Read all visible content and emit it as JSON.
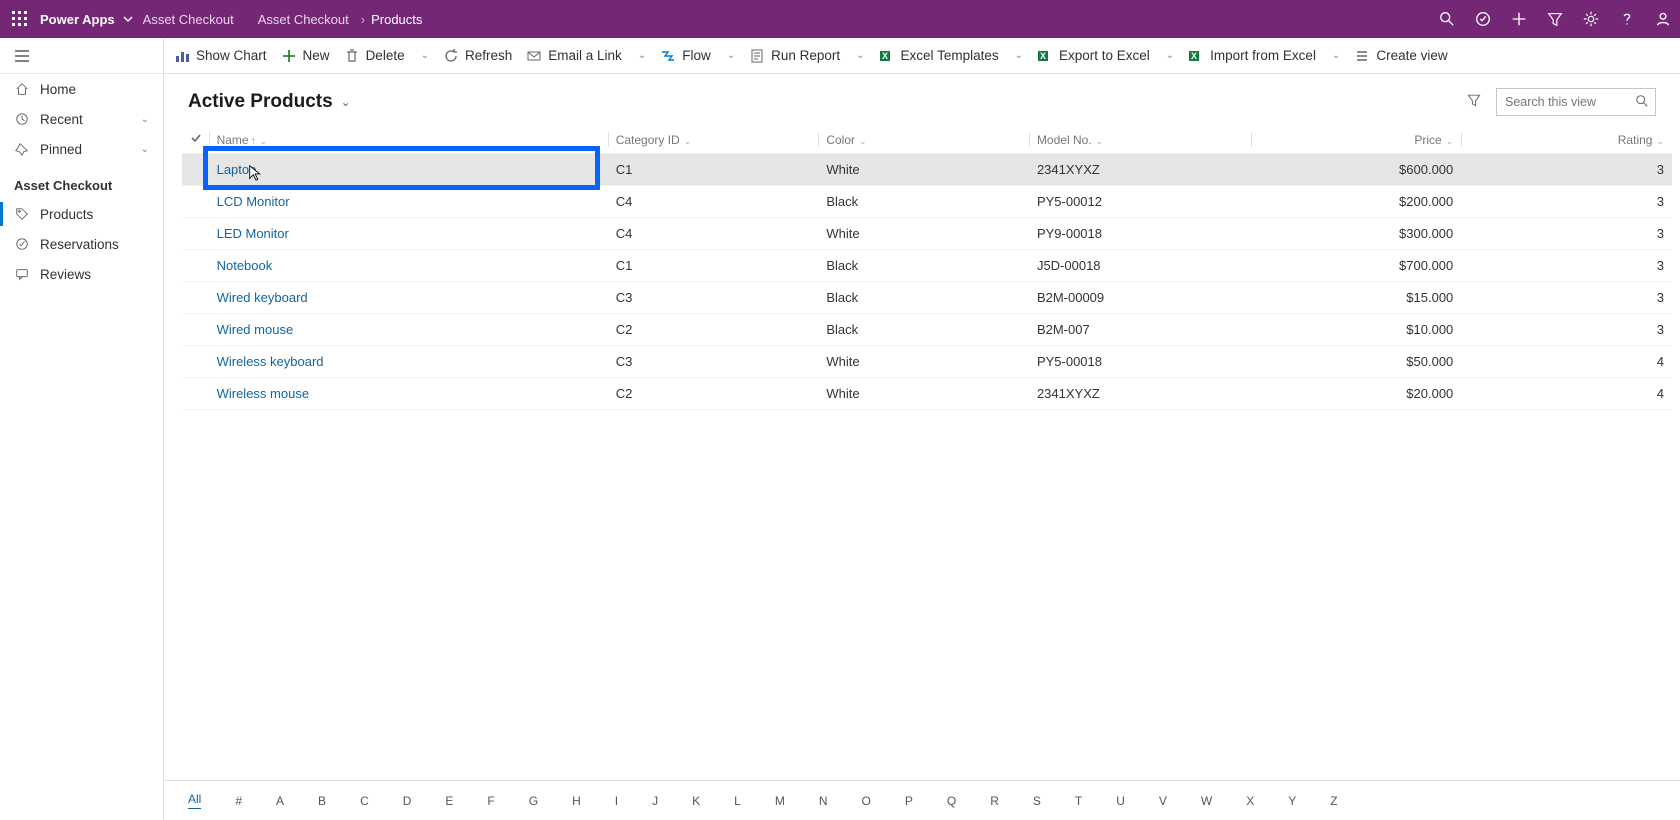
{
  "appbar": {
    "app_name": "Power Apps",
    "env_name": "Asset Checkout",
    "breadcrumb": [
      "Asset Checkout",
      "Products"
    ]
  },
  "commands": {
    "show_chart": "Show Chart",
    "new": "New",
    "delete": "Delete",
    "refresh": "Refresh",
    "email_link": "Email a Link",
    "flow": "Flow",
    "run_report": "Run Report",
    "excel_templates": "Excel Templates",
    "export_excel": "Export to Excel",
    "import_excel": "Import from Excel",
    "create_view": "Create view"
  },
  "nav": {
    "home": "Home",
    "recent": "Recent",
    "pinned": "Pinned",
    "group": "Asset Checkout",
    "products": "Products",
    "reservations": "Reservations",
    "reviews": "Reviews"
  },
  "view": {
    "title": "Active Products",
    "search_placeholder": "Search this view"
  },
  "columns": {
    "name": "Name",
    "category": "Category ID",
    "color": "Color",
    "model": "Model No.",
    "price": "Price",
    "rating": "Rating"
  },
  "rows": [
    {
      "name": "Laptop",
      "category": "C1",
      "color": "White",
      "model": "2341XYXZ",
      "price": "$600.000",
      "rating": "3"
    },
    {
      "name": "LCD Monitor",
      "category": "C4",
      "color": "Black",
      "model": "PY5-00012",
      "price": "$200.000",
      "rating": "3"
    },
    {
      "name": "LED Monitor",
      "category": "C4",
      "color": "White",
      "model": "PY9-00018",
      "price": "$300.000",
      "rating": "3"
    },
    {
      "name": "Notebook",
      "category": "C1",
      "color": "Black",
      "model": "J5D-00018",
      "price": "$700.000",
      "rating": "3"
    },
    {
      "name": "Wired keyboard",
      "category": "C3",
      "color": "Black",
      "model": "B2M-00009",
      "price": "$15.000",
      "rating": "3"
    },
    {
      "name": "Wired mouse",
      "category": "C2",
      "color": "Black",
      "model": "B2M-007",
      "price": "$10.000",
      "rating": "3"
    },
    {
      "name": "Wireless keyboard",
      "category": "C3",
      "color": "White",
      "model": "PY5-00018",
      "price": "$50.000",
      "rating": "4"
    },
    {
      "name": "Wireless mouse",
      "category": "C2",
      "color": "White",
      "model": "2341XYXZ",
      "price": "$20.000",
      "rating": "4"
    }
  ],
  "jumpbar": [
    "All",
    "#",
    "A",
    "B",
    "C",
    "D",
    "E",
    "F",
    "G",
    "H",
    "I",
    "J",
    "K",
    "L",
    "M",
    "N",
    "O",
    "P",
    "Q",
    "R",
    "S",
    "T",
    "U",
    "V",
    "W",
    "X",
    "Y",
    "Z"
  ]
}
